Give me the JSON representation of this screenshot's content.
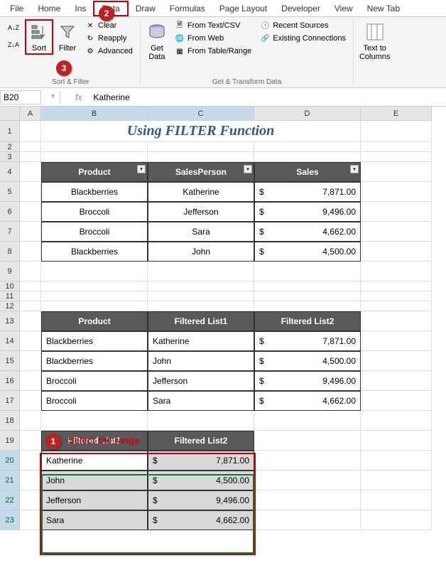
{
  "menu": {
    "tabs": [
      "File",
      "Home",
      "Ins",
      "Data",
      "Draw",
      "Formulas",
      "Page Layout",
      "Developer",
      "View",
      "New Tab"
    ]
  },
  "ribbon": {
    "sort": "Sort",
    "filter": "Filter",
    "clear": "Clear",
    "reapply": "Reapply",
    "advanced": "Advanced",
    "sortFilterGroup": "Sort & Filter",
    "getData": "Get\nData",
    "fromTextCsv": "From Text/CSV",
    "fromWeb": "From Web",
    "fromTableRange": "From Table/Range",
    "recentSources": "Recent Sources",
    "existingConnections": "Existing Connections",
    "transformGroup": "Get & Transform Data",
    "textToColumns": "Text to\nColumns"
  },
  "nameBox": "B20",
  "formula": "Katherine",
  "title": "Using FILTER Function",
  "table1": {
    "headers": [
      "Product",
      "SalesPerson",
      "Sales"
    ],
    "rows": [
      {
        "product": "Blackberries",
        "person": "Katherine",
        "sales": "7,871.00"
      },
      {
        "product": "Broccoli",
        "person": "Jefferson",
        "sales": "9,496.00"
      },
      {
        "product": "Broccoli",
        "person": "Sara",
        "sales": "4,662.00"
      },
      {
        "product": "Blackberries",
        "person": "John",
        "sales": "4,500.00"
      }
    ]
  },
  "table2": {
    "headers": [
      "Product",
      "Filtered List1",
      "Filtered List2"
    ],
    "rows": [
      {
        "product": "Blackberries",
        "l1": "Katherine",
        "l2": "7,871.00"
      },
      {
        "product": "Blackberries",
        "l1": "John",
        "l2": "4,500.00"
      },
      {
        "product": "Broccoli",
        "l1": "Jefferson",
        "l2": "9,496.00"
      },
      {
        "product": "Broccoli",
        "l1": "Sara",
        "l2": "4,662.00"
      }
    ]
  },
  "table3": {
    "headers": [
      "Filtered List1",
      "Filtered List2"
    ],
    "rows": [
      {
        "l1": "Katherine",
        "l2": "7,871.00"
      },
      {
        "l1": "John",
        "l2": "4,500.00"
      },
      {
        "l1": "Jefferson",
        "l2": "9,496.00"
      },
      {
        "l1": "Sara",
        "l2": "4,662.00"
      }
    ]
  },
  "callout": {
    "selectRange": "Select the range"
  },
  "currency": "$",
  "cols": [
    "A",
    "B",
    "C",
    "D",
    "E"
  ],
  "rows": [
    "1",
    "2",
    "3",
    "4",
    "5",
    "6",
    "7",
    "8",
    "9",
    "10",
    "11",
    "12",
    "13",
    "14",
    "15",
    "16",
    "17",
    "18",
    "19",
    "20",
    "21",
    "22",
    "23"
  ]
}
